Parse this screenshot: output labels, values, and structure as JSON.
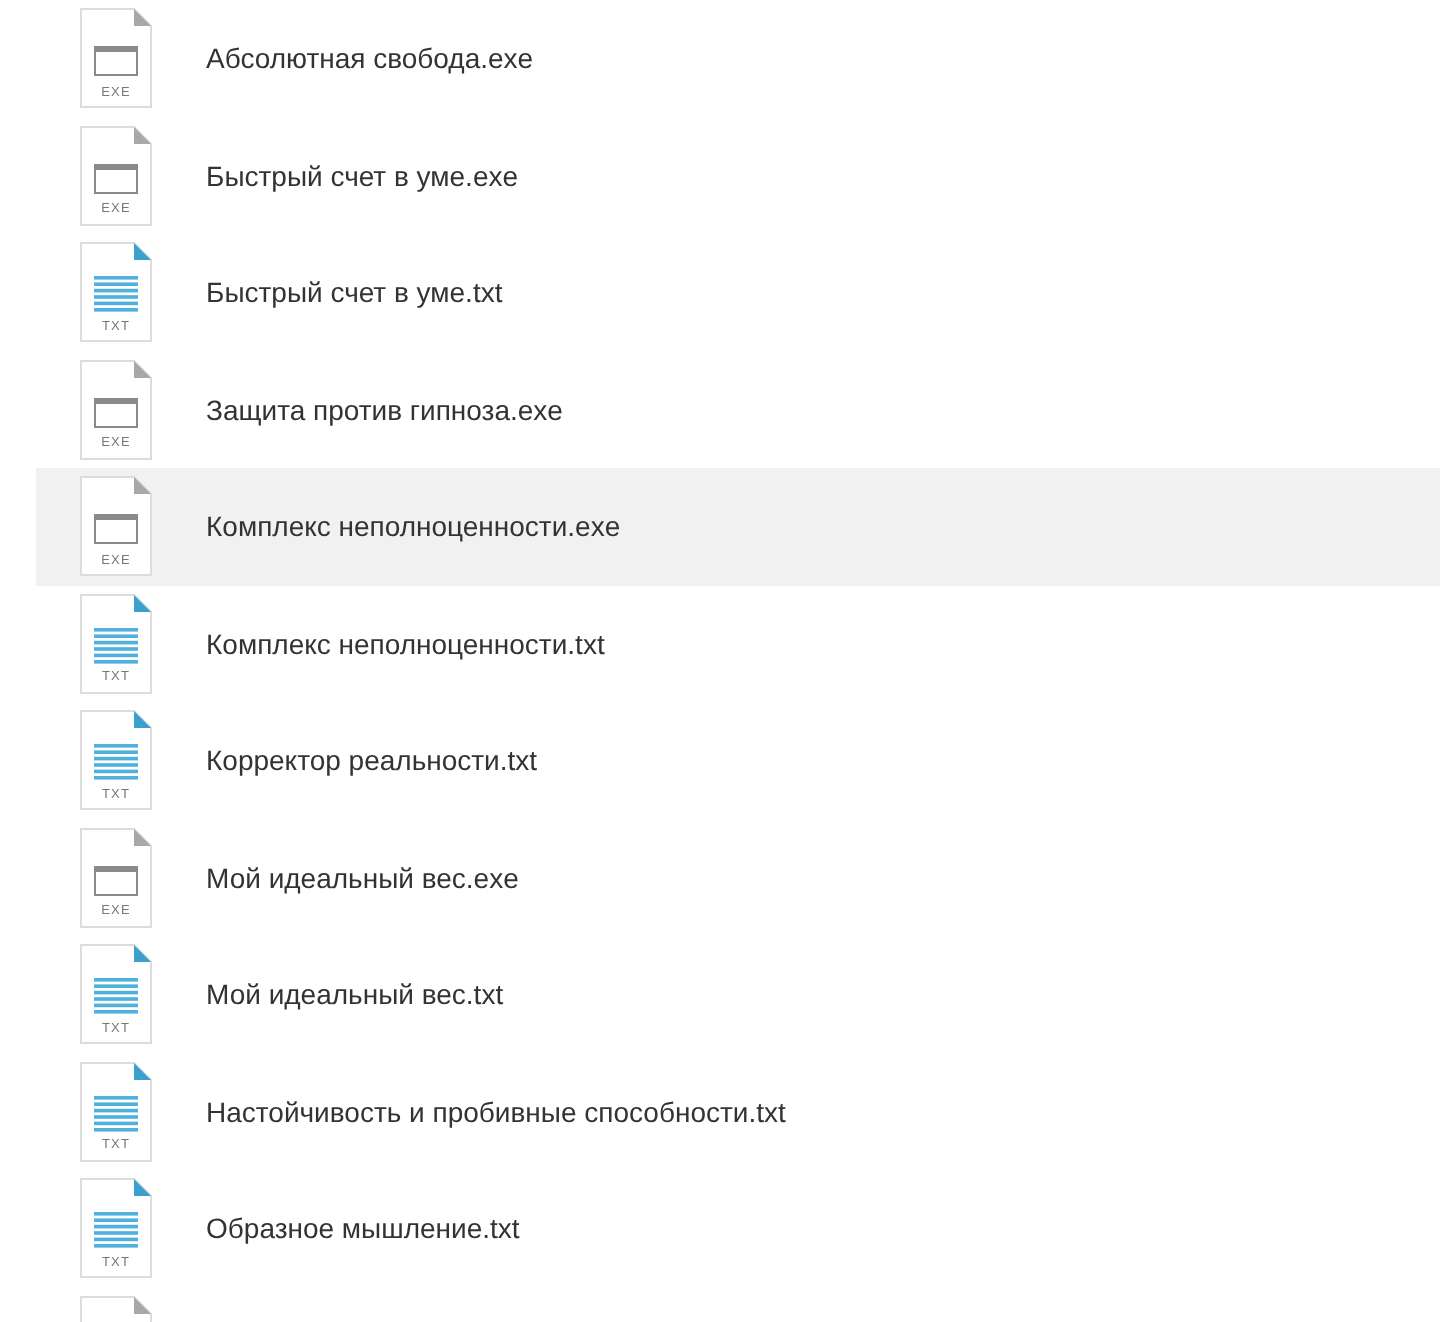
{
  "files": [
    {
      "kind": "exe",
      "badge": "EXE",
      "name": "Абсолютная свобода.exe",
      "highlighted": false
    },
    {
      "kind": "exe",
      "badge": "EXE",
      "name": "Быстрый счет в уме.exe",
      "highlighted": false
    },
    {
      "kind": "txt",
      "badge": "TXT",
      "name": "Быстрый счет в уме.txt",
      "highlighted": false
    },
    {
      "kind": "exe",
      "badge": "EXE",
      "name": "Защита против гипноза.exe",
      "highlighted": false
    },
    {
      "kind": "exe",
      "badge": "EXE",
      "name": "Комплекс неполноценности.exe",
      "highlighted": true
    },
    {
      "kind": "txt",
      "badge": "TXT",
      "name": "Комплекс неполноценности.txt",
      "highlighted": false
    },
    {
      "kind": "txt",
      "badge": "TXT",
      "name": "Корректор реальности.txt",
      "highlighted": false
    },
    {
      "kind": "exe",
      "badge": "EXE",
      "name": "Мой идеальный вес.exe",
      "highlighted": false
    },
    {
      "kind": "txt",
      "badge": "TXT",
      "name": "Мой идеальный вес.txt",
      "highlighted": false
    },
    {
      "kind": "txt",
      "badge": "TXT",
      "name": "Настойчивость и пробивные способности.txt",
      "highlighted": false
    },
    {
      "kind": "txt",
      "badge": "TXT",
      "name": "Образное мышление.txt",
      "highlighted": false
    },
    {
      "kind": "exe",
      "highlighted": false
    }
  ]
}
